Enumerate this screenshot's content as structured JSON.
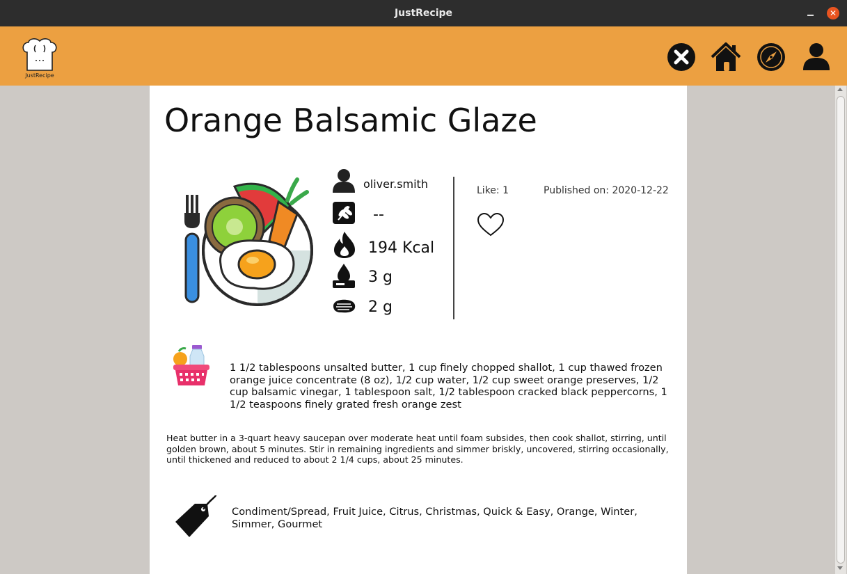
{
  "window": {
    "title": "JustRecipe",
    "close_glyph": "✕"
  },
  "app": {
    "logo_text": "JustRecipe",
    "nav": [
      {
        "name": "close-icon"
      },
      {
        "name": "home-icon"
      },
      {
        "name": "compass-icon"
      },
      {
        "name": "profile-icon"
      }
    ]
  },
  "recipe": {
    "title": "Orange Balsamic Glaze",
    "author": "oliver.smith",
    "category": "--",
    "calories": "194 Kcal",
    "fat": "3 g",
    "protein": "2 g",
    "likes": "Like: 1",
    "published": "Published on: 2020-12-22",
    "ingredients": "1 1/2 tablespoons unsalted butter, 1 cup finely chopped shallot, 1 cup thawed frozen orange juice concentrate (8 oz), 1/2 cup water, 1/2 cup sweet orange preserves, 1/2 cup balsamic vinegar, 1 tablespoon salt, 1/2 tablespoon cracked black peppercorns, 1 1/2 teaspoons finely grated fresh orange zest",
    "directions": "Heat butter in a 3-quart heavy saucepan over moderate heat until foam subsides, then cook shallot, stirring, until golden brown, about 5 minutes. Stir in remaining ingredients and simmer briskly, uncovered, stirring occasionally, until thickened and reduced to about 2 1/4 cups, about 25 minutes.",
    "tags": "Condiment/Spread, Fruit Juice, Citrus, Christmas, Quick & Easy, Orange, Winter, Simmer, Gourmet"
  },
  "colors": {
    "appbar": "#eca041",
    "titlebar": "#2d2d2d",
    "background": "#cdc9c5",
    "card": "#ffffff"
  }
}
